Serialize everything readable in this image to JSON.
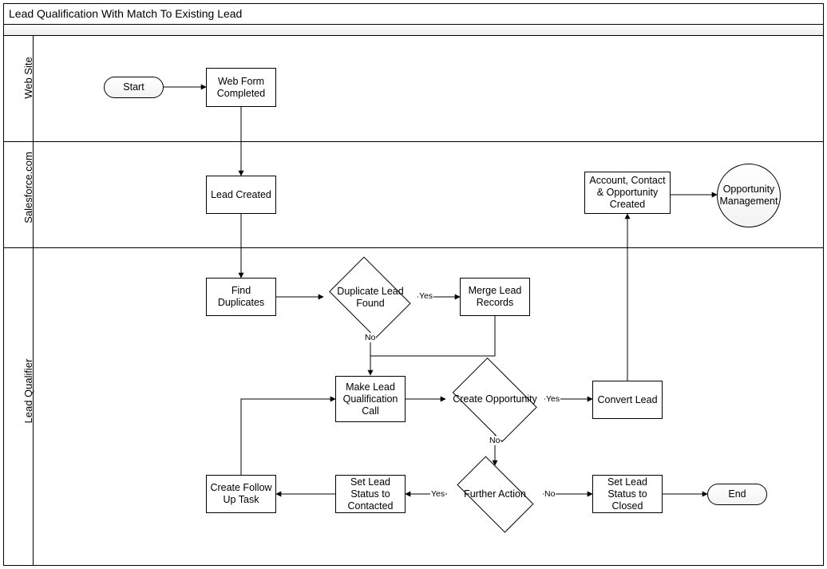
{
  "title": "Lead Qualification With Match To Existing Lead",
  "lanes": {
    "web_site": "Web Site",
    "salesforce": "Salesforce.com",
    "lead_qualifier": "Lead Qualifier"
  },
  "nodes": {
    "start": "Start",
    "web_form_completed": "Web Form Completed",
    "lead_created": "Lead Created",
    "find_duplicates": "Find Duplicates",
    "duplicate_lead_found": "Duplicate Lead Found",
    "merge_lead_records": "Merge Lead Records",
    "make_lead_qualification_call": "Make Lead Qualification Call",
    "create_opportunity": "Create Opportunity",
    "convert_lead": "Convert Lead",
    "account_contact_opportunity_created": "Account, Contact & Opportunity Created",
    "opportunity_management": "Opportunity Management",
    "further_action": "Further Action",
    "set_lead_status_contacted": "Set Lead Status to Contacted",
    "create_follow_up_task": "Create Follow Up Task",
    "set_lead_status_closed": "Set Lead Status to Closed",
    "end": "End"
  },
  "edge_labels": {
    "yes": "Yes",
    "no": "No"
  }
}
